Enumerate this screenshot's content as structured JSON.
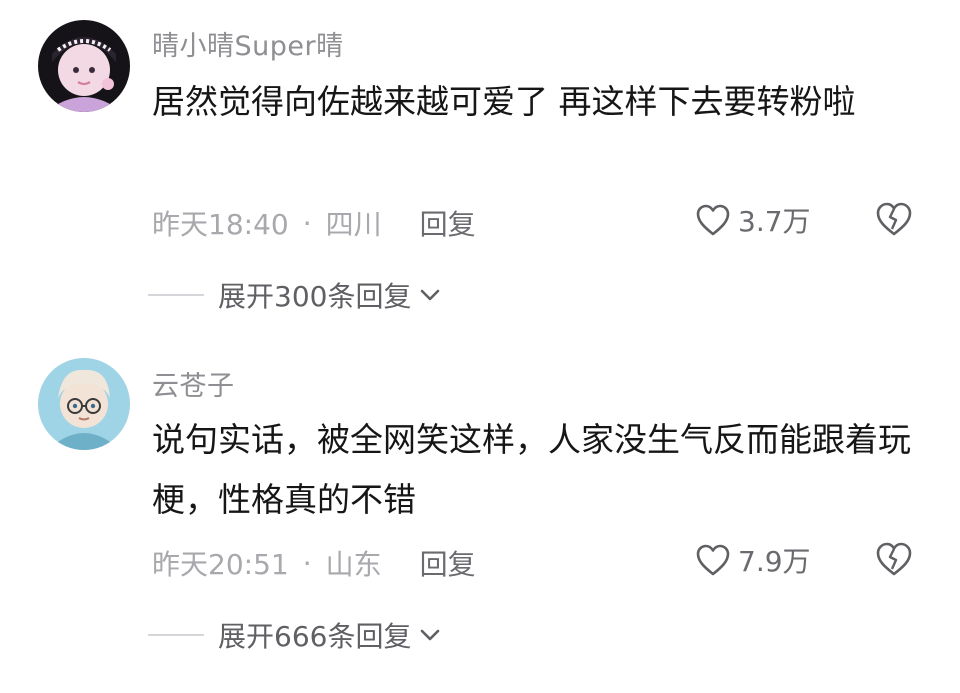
{
  "comments": [
    {
      "username": "晴小晴Super晴",
      "text": "居然觉得向佐越来越可爱了 再这样下去要转粉啦",
      "time": "昨天18:40",
      "location": "四川",
      "reply_label": "回复",
      "likes": "3.7万",
      "expand_label": "展开300条回复"
    },
    {
      "username": "云苍子",
      "text": "说句实话，被全网笑这样，人家没生气反而能跟着玩梗，性格真的不错",
      "time": "昨天20:51",
      "location": "山东",
      "reply_label": "回复",
      "likes": "7.9万",
      "expand_label": "展开666条回复"
    }
  ],
  "separator": "·",
  "icons": {
    "like": "heart-outline-icon",
    "dislike": "broken-heart-icon",
    "expand": "chevron-down-icon"
  },
  "colors": {
    "username": "#8e8e93",
    "meta": "#a8a8ad",
    "text": "#161616"
  }
}
